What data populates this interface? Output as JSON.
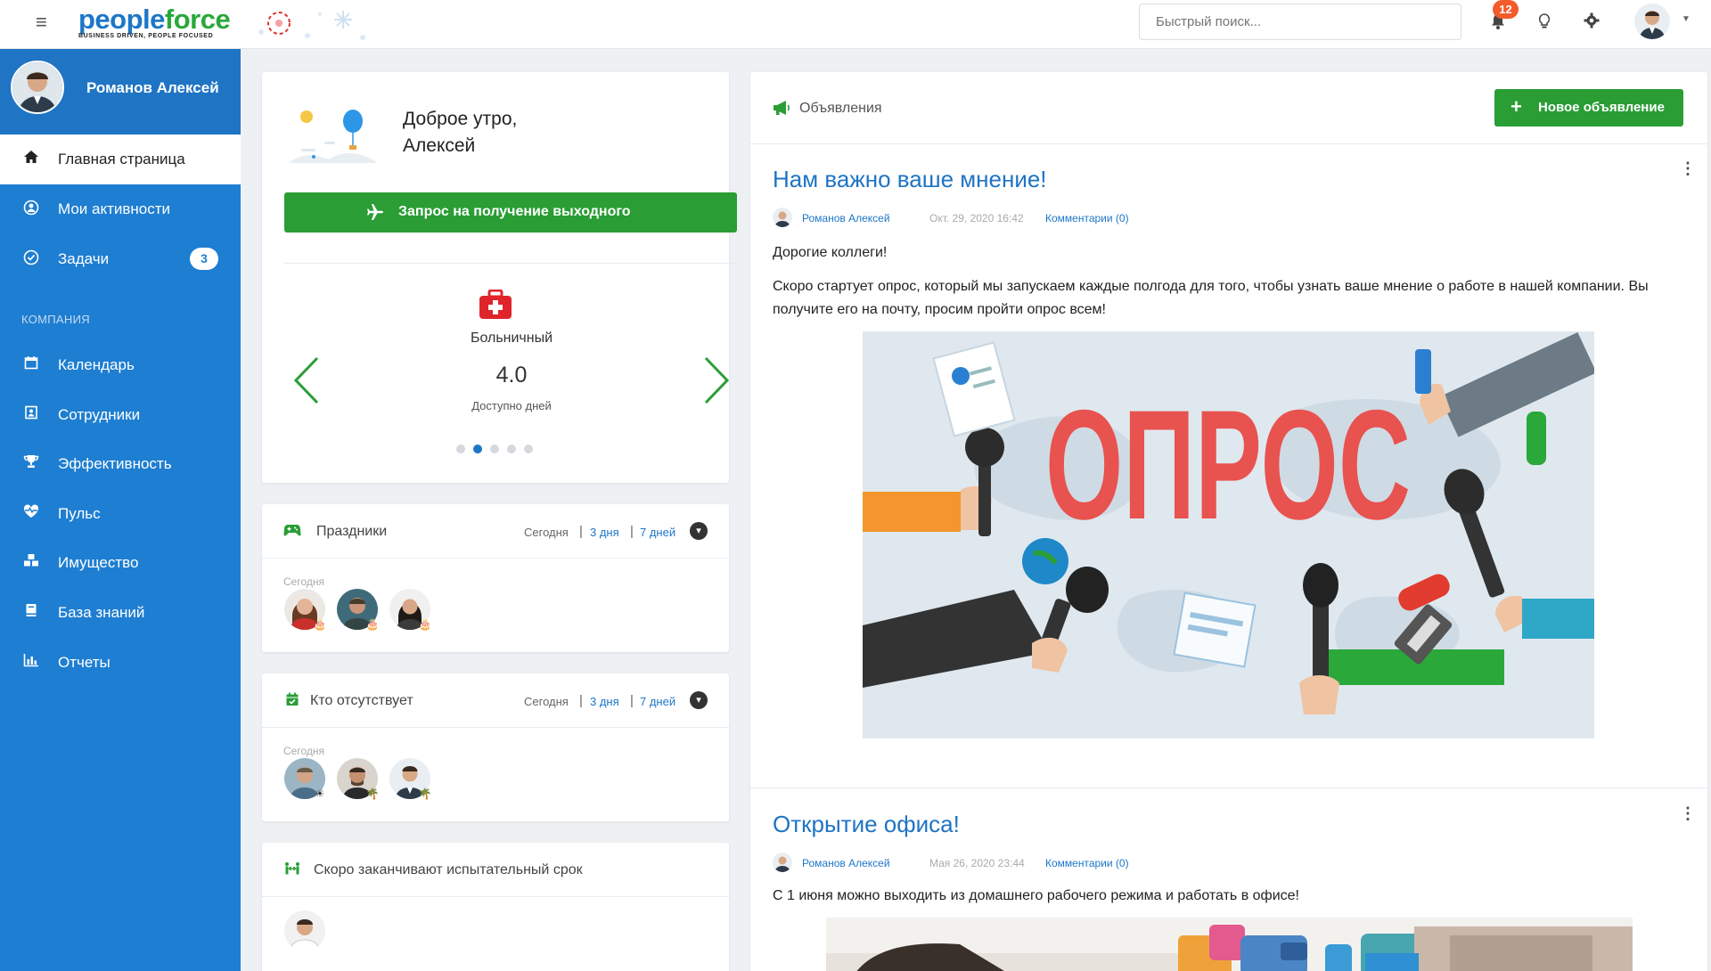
{
  "header": {
    "logo_people": "people",
    "logo_force": "force",
    "logo_tagline": "BUSINESS DRIVEN, PEOPLE FOCUSED",
    "search_placeholder": "Быстрый поиск...",
    "notifications_count": "12",
    "icons": [
      "menu-icon",
      "bell-icon",
      "lightbulb-icon",
      "gear-icon"
    ]
  },
  "sidebar": {
    "user_name": "Романов Алексей",
    "items": [
      {
        "label": "Главная страница",
        "icon": "home-icon",
        "active": true
      },
      {
        "label": "Мои активности",
        "icon": "user-circle-icon"
      },
      {
        "label": "Задачи",
        "icon": "check-circle-icon",
        "badge": "3"
      }
    ],
    "section_label": "КОМПАНИЯ",
    "company_items": [
      {
        "label": "Календарь",
        "icon": "calendar-icon"
      },
      {
        "label": "Сотрудники",
        "icon": "id-card-icon"
      },
      {
        "label": "Эффективность",
        "icon": "trophy-icon"
      },
      {
        "label": "Пульс",
        "icon": "heartbeat-icon"
      },
      {
        "label": "Имущество",
        "icon": "cubes-icon"
      },
      {
        "label": "База знаний",
        "icon": "book-icon"
      },
      {
        "label": "Отчеты",
        "icon": "bar-chart-icon"
      }
    ]
  },
  "greeting": {
    "line1": "Доброе утро,",
    "line2": "Алексей",
    "leave_button": "Запрос на получение выходного",
    "leave_type": "Больничный",
    "days_value": "4.0",
    "days_label": "Доступно дней",
    "carousel_total": 5,
    "carousel_active": 2
  },
  "holidays": {
    "title": "Праздники",
    "filter_today": "Сегодня",
    "filter_3": "3 дня",
    "filter_7": "7 дней",
    "sub": "Сегодня"
  },
  "absent": {
    "title": "Кто отсутствует",
    "filter_today": "Сегодня",
    "filter_3": "3 дня",
    "filter_7": "7 дней",
    "sub": "Сегодня"
  },
  "probation": {
    "title": "Скоро заканчивают испытательный срок"
  },
  "announcements": {
    "title": "Объявления",
    "new_button": "Новое объявление",
    "posts": [
      {
        "title": "Нам важно ваше мнение!",
        "author": "Романов Алексей",
        "date": "Окт. 29, 2020 16:42",
        "comments": "Комментарии (0)",
        "body1": "Дорогие коллеги!",
        "body2": "Скоро стартует опрос, который мы запускаем каждые полгода для того, чтобы узнать ваше мнение о работе в нашей компании. Вы получите его на почту, просим пройти опрос всем!",
        "image_text": "ОПРОС"
      },
      {
        "title": "Открытие офиса!",
        "author": "Романов Алексей",
        "date": "Мая 26, 2020 23:44",
        "comments": "Комментарии (0)",
        "body1": "С 1 июня можно выходить из домашнего рабочего режима и работать в офисе!"
      }
    ]
  },
  "colors": {
    "brand_blue": "#1d76c8",
    "sidebar_blue": "#1e7ed1",
    "action_green": "#2a9d35",
    "badge_orange": "#f35b2a"
  }
}
